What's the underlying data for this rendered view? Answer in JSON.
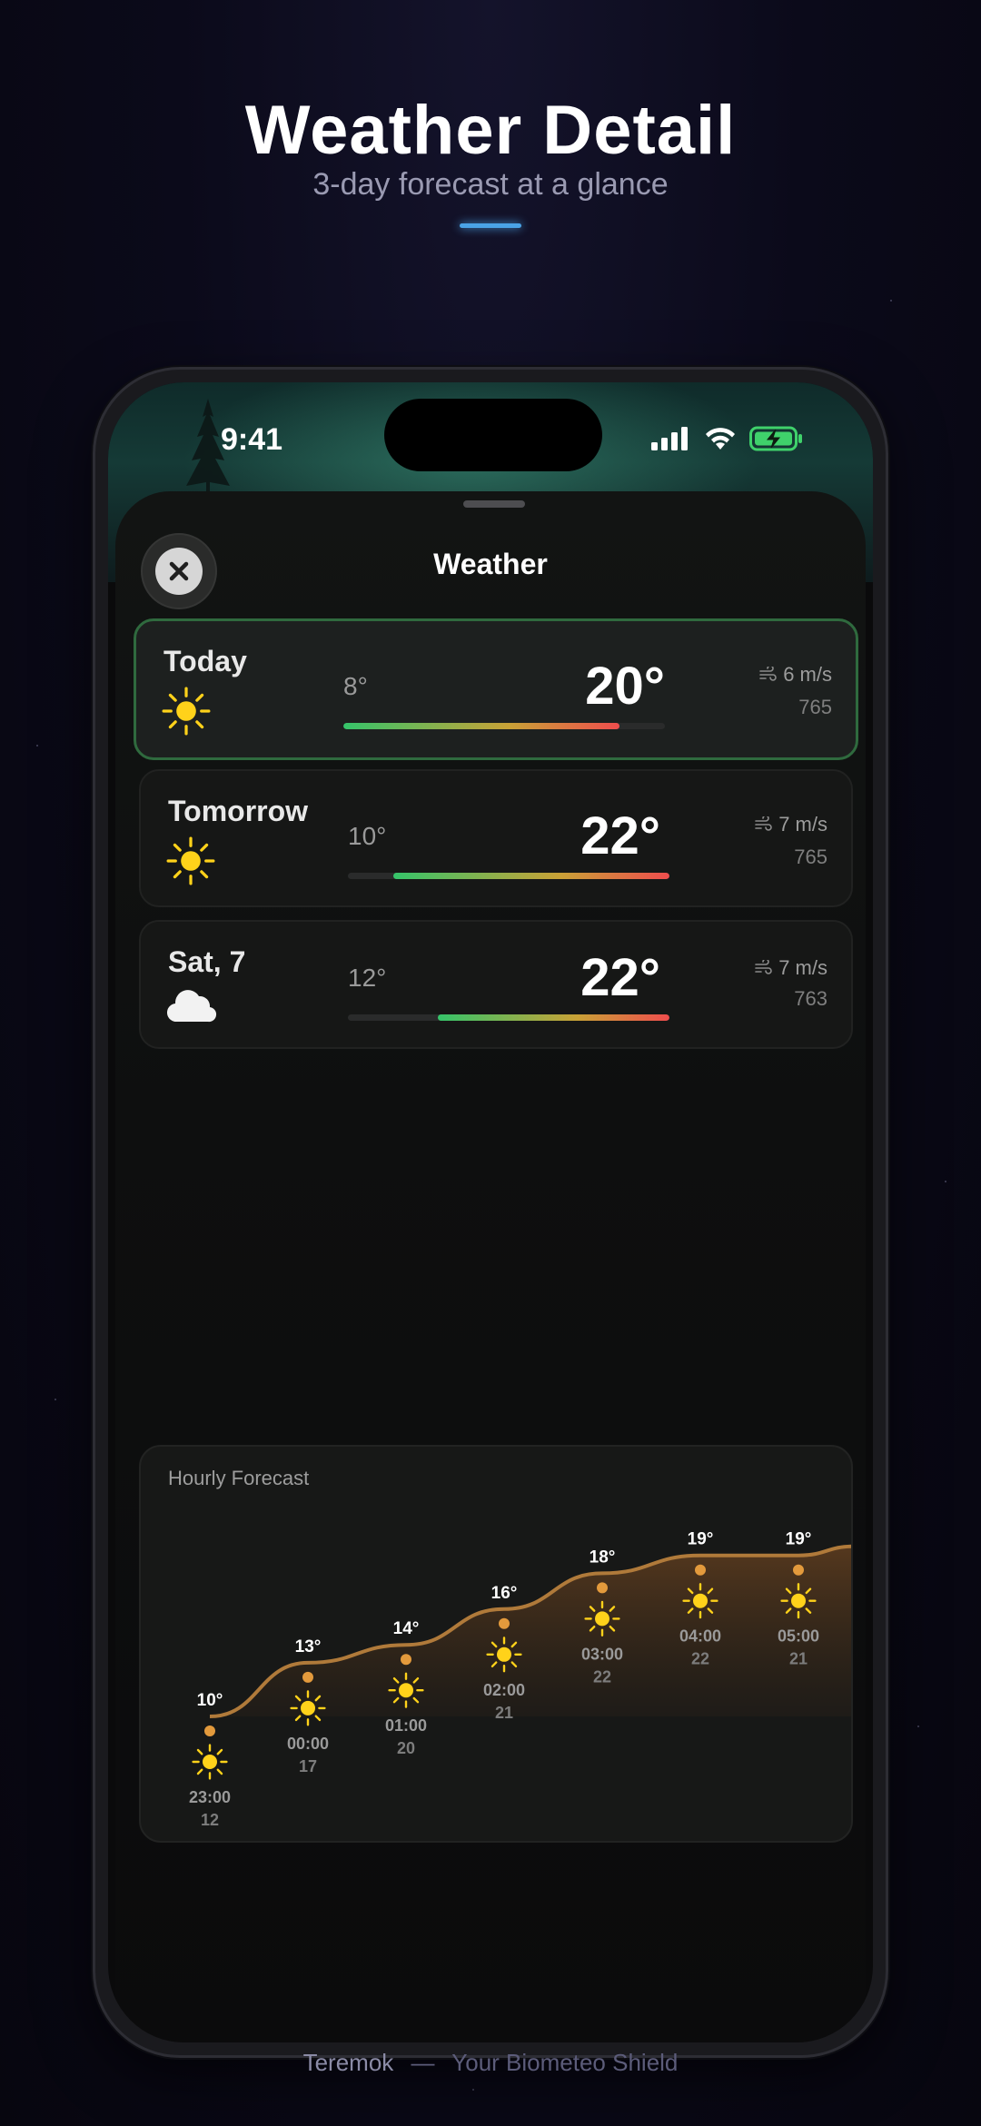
{
  "hero": {
    "title": "Weather Detail",
    "subtitle": "3-day forecast at a glance"
  },
  "footer": {
    "brand": "Teremok",
    "separator": "—",
    "tagline": "Your Biometeo Shield"
  },
  "status_bar": {
    "time": "9:41",
    "icons": [
      "signal-icon",
      "wifi-icon",
      "battery-charging-icon"
    ]
  },
  "sheet": {
    "title": "Weather",
    "close_icon": "close-icon"
  },
  "days": [
    {
      "name": "Today",
      "icon": "sun-icon",
      "low": "8°",
      "high": "20°",
      "range": [
        0.0,
        0.86
      ],
      "wind": "6 m/s",
      "pressure": "765",
      "active": true
    },
    {
      "name": "Tomorrow",
      "icon": "sun-icon",
      "low": "10°",
      "high": "22°",
      "range": [
        0.14,
        1.0
      ],
      "wind": "7 m/s",
      "pressure": "765",
      "active": false
    },
    {
      "name": "Sat, 7",
      "icon": "cloud-icon",
      "low": "12°",
      "high": "22°",
      "range": [
        0.28,
        1.0
      ],
      "wind": "7 m/s",
      "pressure": "763",
      "active": false
    }
  ],
  "colors": {
    "active_border": "#2f6a3e",
    "range_start": "#35c46a",
    "range_mid": "#c9a236",
    "range_end": "#ef4d4d",
    "sun": "#ffd21a",
    "curve": "#b07a3a",
    "hero_accent": "#4aa3e6"
  },
  "hourly": {
    "title": "Hourly Forecast",
    "items": [
      {
        "time": "23:00",
        "temp": "10°",
        "value": 10,
        "sub": "12",
        "icon": "sun-icon"
      },
      {
        "time": "00:00",
        "temp": "13°",
        "value": 13,
        "sub": "17",
        "icon": "sun-icon"
      },
      {
        "time": "01:00",
        "temp": "14°",
        "value": 14,
        "sub": "20",
        "icon": "sun-icon"
      },
      {
        "time": "02:00",
        "temp": "16°",
        "value": 16,
        "sub": "21",
        "icon": "sun-icon"
      },
      {
        "time": "03:00",
        "temp": "18°",
        "value": 18,
        "sub": "22",
        "icon": "sun-icon"
      },
      {
        "time": "04:00",
        "temp": "19°",
        "value": 19,
        "sub": "22",
        "icon": "sun-icon"
      },
      {
        "time": "05:00",
        "temp": "19°",
        "value": 19,
        "sub": "21",
        "icon": "sun-icon"
      }
    ]
  }
}
